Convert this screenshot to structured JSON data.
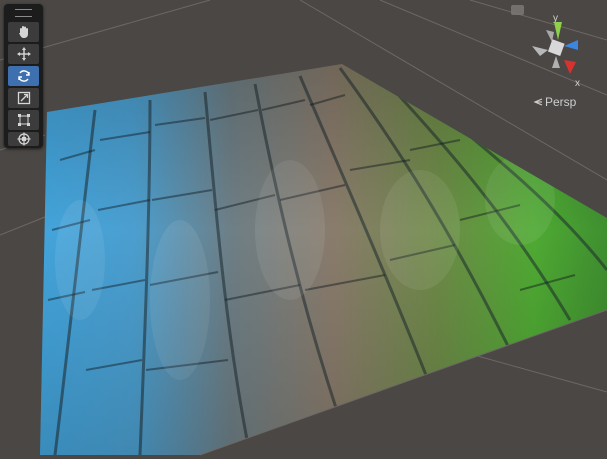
{
  "toolbar": {
    "tools": [
      {
        "name": "view-tool",
        "icon": "hand-icon",
        "active": false
      },
      {
        "name": "move-tool",
        "icon": "move-arrows-icon",
        "active": false
      },
      {
        "name": "rotate-tool",
        "icon": "rotate-icon",
        "active": true
      },
      {
        "name": "scale-tool",
        "icon": "scale-icon",
        "active": false
      },
      {
        "name": "rect-tool",
        "icon": "rect-transform-icon",
        "active": false
      },
      {
        "name": "transform-tool",
        "icon": "transform-gizmo-icon",
        "active": false
      }
    ]
  },
  "gizmo": {
    "y_label": "y",
    "x_label": "x",
    "colors": {
      "x": "#d8322f",
      "y": "#8ed04a",
      "z": "#3a86e0",
      "center": "#d8d8d8"
    }
  },
  "projection": {
    "label": "Persp",
    "chevron_icon": "chevron-left-icon"
  },
  "colors": {
    "background": "#4a4744",
    "grid": "#6c6865",
    "active_tool": "#3e6fae",
    "water": "#3aa8e6",
    "rock": "#8a7a6a",
    "moss": "#4fb832"
  }
}
